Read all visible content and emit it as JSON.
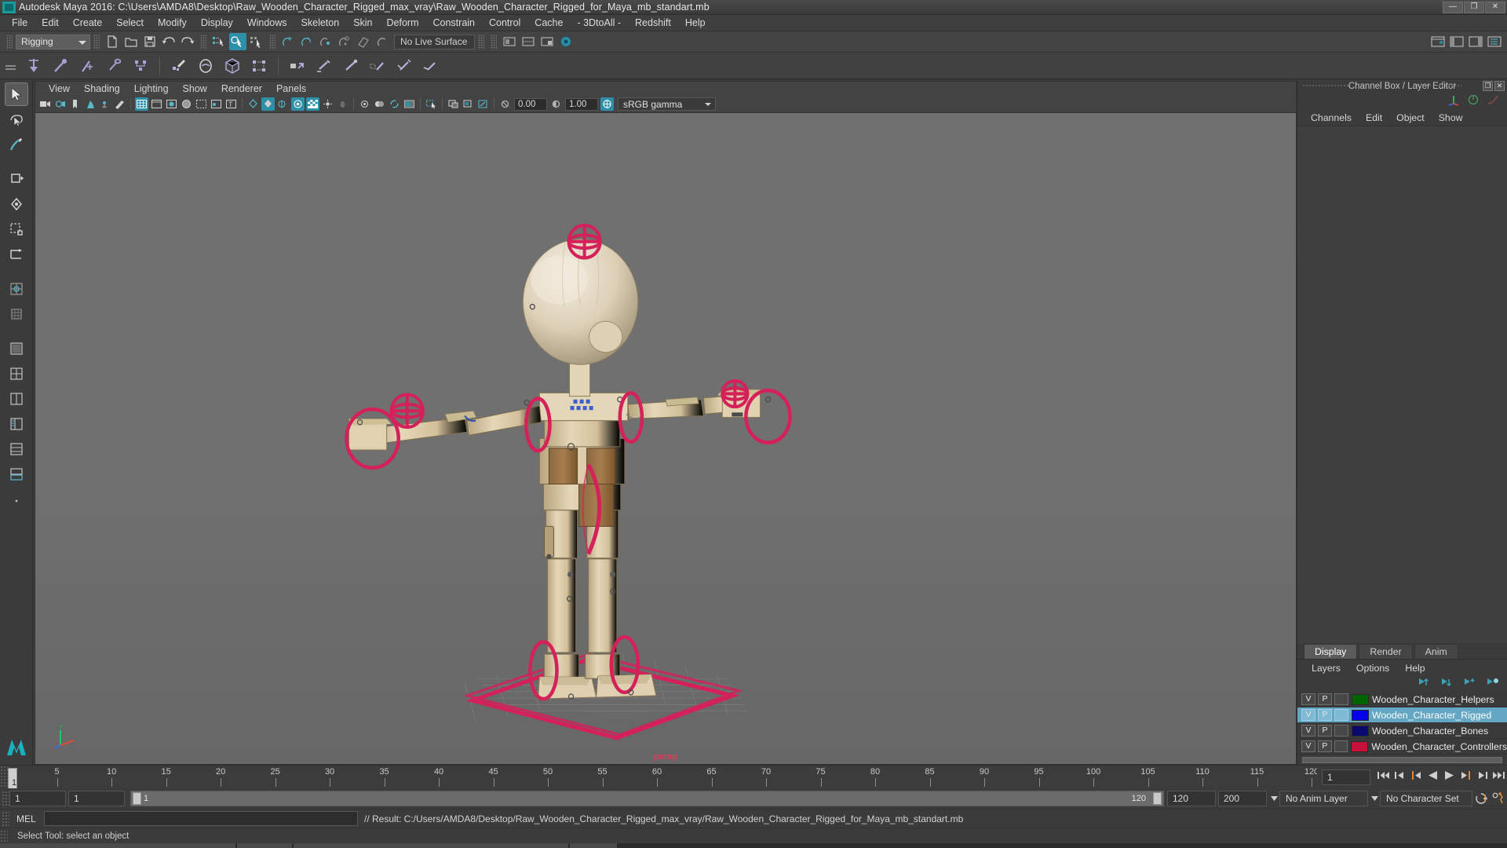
{
  "window": {
    "title": "Autodesk Maya 2016: C:\\Users\\AMDA8\\Desktop\\Raw_Wooden_Character_Rigged_max_vray\\Raw_Wooden_Character_Rigged_for_Maya_mb_standart.mb",
    "minimize": "—",
    "maximize": "❐",
    "close": "✕"
  },
  "menubar": {
    "items": [
      {
        "label": "File"
      },
      {
        "label": "Edit"
      },
      {
        "label": "Create"
      },
      {
        "label": "Select"
      },
      {
        "label": "Modify"
      },
      {
        "label": "Display"
      },
      {
        "label": "Windows"
      },
      {
        "label": "Skeleton"
      },
      {
        "label": "Skin"
      },
      {
        "label": "Deform"
      },
      {
        "label": "Constrain"
      },
      {
        "label": "Control"
      },
      {
        "label": "Cache"
      },
      {
        "label": "- 3DtoAll -"
      },
      {
        "label": "Redshift"
      },
      {
        "label": "Help"
      }
    ]
  },
  "statusline": {
    "menuset": "Rigging",
    "live_surface": "No Live Surface"
  },
  "viewport_panel": {
    "menus": [
      {
        "label": "View"
      },
      {
        "label": "Shading"
      },
      {
        "label": "Lighting"
      },
      {
        "label": "Show"
      },
      {
        "label": "Renderer"
      },
      {
        "label": "Panels"
      }
    ],
    "exposure_value": "0.00",
    "gamma_value": "1.00",
    "color_profile": "sRGB gamma",
    "camera_label": "persp"
  },
  "channelbox": {
    "panel_title": "Channel Box / Layer Editor",
    "menus": [
      {
        "label": "Channels"
      },
      {
        "label": "Edit"
      },
      {
        "label": "Object"
      },
      {
        "label": "Show"
      }
    ]
  },
  "layer_editor": {
    "tabs": [
      {
        "label": "Display",
        "active": true
      },
      {
        "label": "Render",
        "active": false
      },
      {
        "label": "Anim",
        "active": false
      }
    ],
    "menus": [
      {
        "label": "Layers"
      },
      {
        "label": "Options"
      },
      {
        "label": "Help"
      }
    ],
    "visibility_flag": "V",
    "playback_flag": "P",
    "layers": [
      {
        "name": "Wooden_Character_Helpers",
        "color": "#006400",
        "selected": false
      },
      {
        "name": "Wooden_Character_Rigged",
        "color": "#0000ee",
        "selected": true
      },
      {
        "name": "Wooden_Character_Bones",
        "color": "#0a0a6e",
        "selected": false
      },
      {
        "name": "Wooden_Character_Controllers",
        "color": "#c8103c",
        "selected": false
      }
    ]
  },
  "timeslider": {
    "ticks": [
      5,
      10,
      15,
      20,
      25,
      30,
      35,
      40,
      45,
      50,
      55,
      60,
      65,
      70,
      75,
      80,
      85,
      90,
      95,
      100,
      105,
      110,
      115,
      120
    ],
    "start": 1,
    "end": 120,
    "current_frame": "1",
    "current_frame_field": "1"
  },
  "rangeslider": {
    "anim_start": "1",
    "range_start": "1",
    "bar_start_label": "1",
    "bar_end_label": "120",
    "range_end": "120",
    "anim_end": "200",
    "anim_layer": "No Anim Layer",
    "character_set": "No Character Set"
  },
  "commandline": {
    "language": "MEL",
    "input_value": "",
    "result": "// Result: C:/Users/AMDA8/Desktop/Raw_Wooden_Character_Rigged_max_vray/Raw_Wooden_Character_Rigged_for_Maya_mb_standart.mb"
  },
  "helpline": {
    "text": "Select Tool: select an object"
  },
  "colors": {
    "accent_teal": "#2d8fa8",
    "controller_red": "#d4215a",
    "selection_blue": "#63a7c4",
    "wood_light": "#d8c9a8"
  }
}
